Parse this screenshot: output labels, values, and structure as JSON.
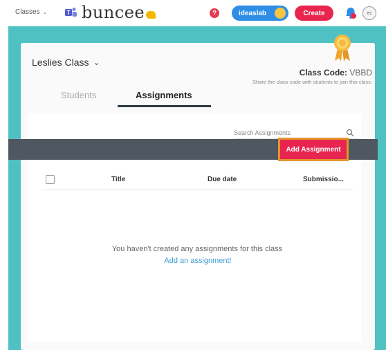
{
  "header": {
    "classes_label": "Classes",
    "logo_text": "buncee",
    "help_label": "?",
    "ideaslab_label": "ideaslab",
    "create_label": "Create",
    "avatar_label": "ec"
  },
  "class": {
    "name": "Leslies Class",
    "code_label": "Class Code:",
    "code_value": "VBBD",
    "code_hint": "Share the class code with students to join this class."
  },
  "tabs": {
    "students": "Students",
    "assignments": "Assignments"
  },
  "search": {
    "label": "Search Assignments"
  },
  "toolbar": {
    "add_label": "Add Assignment"
  },
  "table": {
    "columns": [
      "Title",
      "Due date",
      "Submissio..."
    ]
  },
  "empty": {
    "message": "You haven't created any assignments for this class",
    "link": "Add an assignment!"
  },
  "colors": {
    "teal": "#4fc1c2",
    "accent_red": "#e8254f",
    "highlight_orange": "#e3962b",
    "link_blue": "#3a9bd5"
  }
}
